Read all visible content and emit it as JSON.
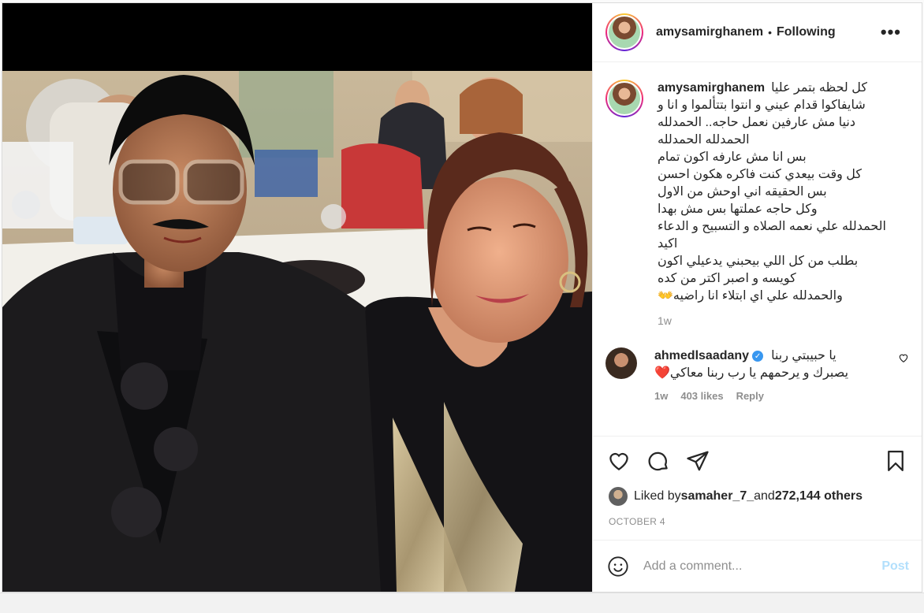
{
  "post": {
    "author": "amysamirghanem",
    "follow_separator": "•",
    "follow_status": "Following",
    "more_label": "•••"
  },
  "caption": {
    "username": "amysamirghanem",
    "lines": [
      "كل لحظه بتمر عليا",
      "شايفاكوا قدام عيني و انتوا بتتألموا و انا و",
      "دنيا مش عارفين نعمل حاجه.. الحمدلله",
      "الحمدلله الحمدلله",
      "بس انا مش عارفه اكون تمام",
      "كل وقت بيعدي كنت فاكره هكون احسن",
      "بس الحقيقه اني اوحش من الاول",
      "وكل حاجه عملتها بس مش بهدا",
      "الحمدلله علي نعمه الصلاه و التسبيح و الدعاء",
      "اكيد",
      "بطلب من كل اللي بيحبني يدعيلي اكون",
      "كويسه و اصبر اكتر من كده",
      "والحمدلله علي اي ابتلاء انا راضيه👐"
    ],
    "time": "1w"
  },
  "comment": {
    "username": "ahmedlsaadany",
    "verified_mark": "✓",
    "line1": "يا حبيبتي ربنا",
    "line2": "يصبرك و يرحمهم يا رب ربنا معاكي❤️",
    "time": "1w",
    "likes": "403 likes",
    "reply": "Reply"
  },
  "likes": {
    "prefix": "Liked by ",
    "user": "samaher_7_",
    "middle": " and ",
    "count": "272,144 others"
  },
  "date": "OCTOBER 4",
  "add_comment": {
    "placeholder": "Add a comment...",
    "post_label": "Post"
  },
  "colors": {
    "accent": "#3897f0",
    "post_disabled": "#b2dffc",
    "muted": "#8e8e8e",
    "heart_red": "#ed4956"
  }
}
